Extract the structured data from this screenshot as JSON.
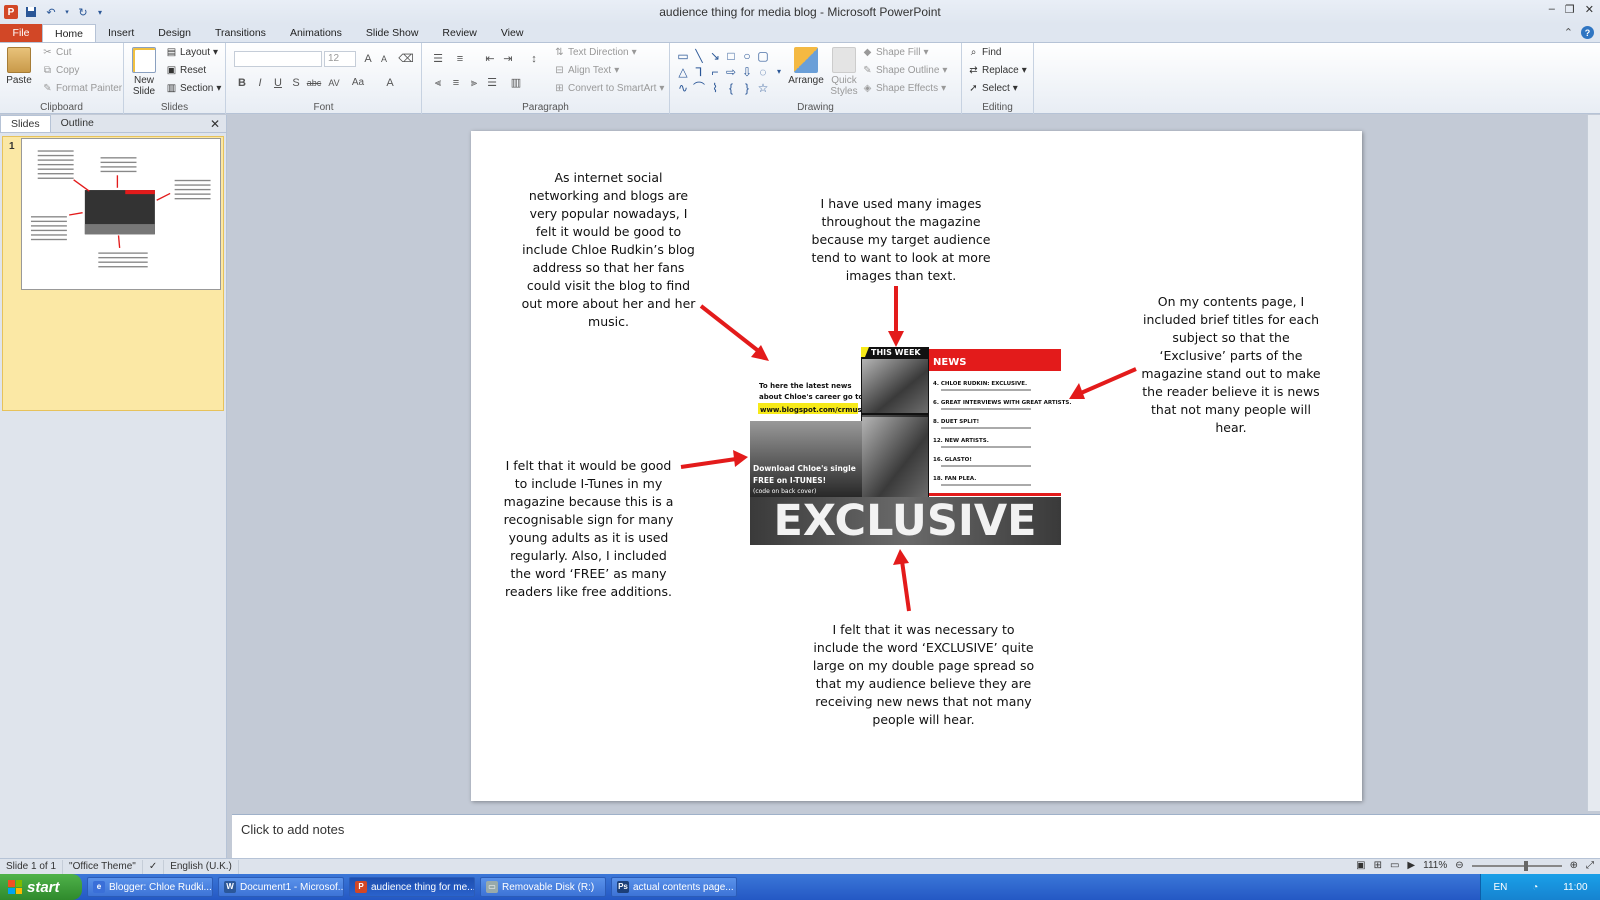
{
  "window": {
    "title": "audience thing for media blog  -  Microsoft PowerPoint",
    "minimize": "–",
    "maximize": "❐",
    "close": "✕"
  },
  "qat": {
    "app_logo": "P"
  },
  "ribbon_tabs": [
    "File",
    "Home",
    "Insert",
    "Design",
    "Transitions",
    "Animations",
    "Slide Show",
    "Review",
    "View"
  ],
  "ribbon": {
    "clipboard": {
      "paste": "Paste",
      "cut": "Cut",
      "copy": "Copy",
      "format_painter": "Format Painter",
      "label": "Clipboard"
    },
    "slides": {
      "new_slide": "New Slide",
      "layout": "Layout",
      "reset": "Reset",
      "section": "Section",
      "label": "Slides"
    },
    "font": {
      "size": "12",
      "label": "Font",
      "bold": "B",
      "italic": "I",
      "underline": "U",
      "shadow": "S",
      "strike": "abc",
      "spacing": "AV",
      "case": "Aa",
      "color": "A",
      "grow": "A",
      "shrink": "A"
    },
    "paragraph": {
      "text_direction": "Text Direction",
      "align_text": "Align Text",
      "smartart": "Convert to SmartArt",
      "label": "Paragraph"
    },
    "drawing": {
      "arrange": "Arrange",
      "quick_styles": "Quick Styles",
      "shape_fill": "Shape Fill",
      "shape_outline": "Shape Outline",
      "shape_effects": "Shape Effects",
      "label": "Drawing"
    },
    "editing": {
      "find": "Find",
      "replace": "Replace",
      "select": "Select",
      "label": "Editing"
    }
  },
  "left_pane": {
    "tabs": [
      "Slides",
      "Outline"
    ],
    "close": "✕",
    "slide_number": "1"
  },
  "slide": {
    "notes": [
      "As internet social networking and blogs are very popular nowadays, I felt it would be good to include Chloe Rudkin’s blog address so that her fans could visit the blog to find out more about her and her music.",
      "I have used many images throughout the magazine because my target audience tend to want to look at more images than text.",
      "On my contents page, I included brief titles for each subject so that the ‘Exclusive’ parts of the magazine stand out to make the reader believe it is news that not many people will hear.",
      "I felt that it would be good to include I-Tunes in my magazine because this is a recognisable sign for many young adults as it is used regularly. Also, I included the word ‘FREE’ as many readers like free additions.",
      "I felt that it was necessary to include the word ‘EXCLUSIVE’ quite large on my double page spread so that my audience believe they are receiving new news that not many people will hear."
    ],
    "magazine": {
      "blog_text_1": "To here the latest news",
      "blog_text_2": "about Chloe's career go to...",
      "blog_url": "www.blogspot.com/crmusic",
      "this_week": "THIS WEEK",
      "news": "NEWS",
      "itunes_1": "Download Chloe's single",
      "itunes_2": "FREE on I-TUNES!",
      "itunes_3": "(code on back cover)",
      "exclusive": "EXCLUSIVE",
      "contents": [
        {
          "num": "4.",
          "title": "CHLOE RUDKIN: EXCLUSIVE."
        },
        {
          "num": "6.",
          "title": "GREAT INTERVIEWS WITH GREAT ARTISTS."
        },
        {
          "num": "8.",
          "title": "DUET SPLIT!"
        },
        {
          "num": "12.",
          "title": "NEW ARTISTS."
        },
        {
          "num": "16.",
          "title": "GLASTO!"
        },
        {
          "num": "18.",
          "title": "FAN PLEA."
        }
      ]
    }
  },
  "notes_pane": {
    "placeholder": "Click to add notes"
  },
  "status": {
    "slide": "Slide 1 of 1",
    "theme": "\"Office Theme\"",
    "language": "English (U.K.)",
    "zoom": "111%"
  },
  "taskbar": {
    "start": "start",
    "items": [
      "Blogger: Chloe Rudki...",
      "Document1 - Microsof...",
      "audience thing for me...",
      "Removable Disk (R:)",
      "actual contents page..."
    ],
    "lang": "EN",
    "clock": "11:00"
  },
  "colors": {
    "accent_red": "#e31b1b",
    "file_tab": "#d24726",
    "taskbar": "#2458c4"
  }
}
